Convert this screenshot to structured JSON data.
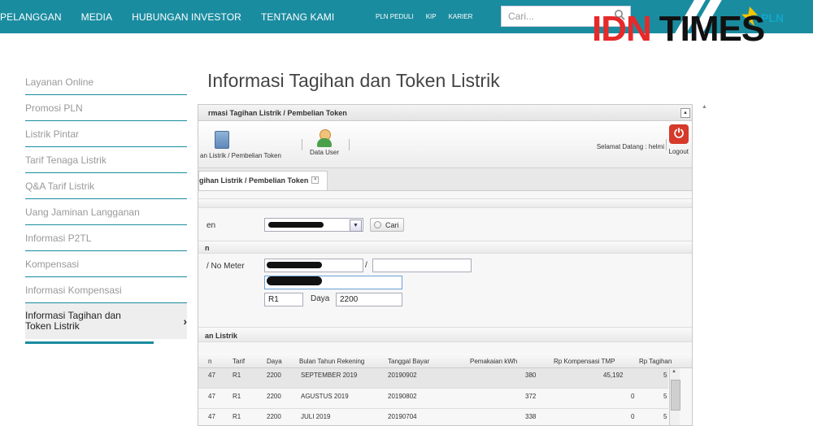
{
  "nav": {
    "main": [
      "PELANGGAN",
      "MEDIA",
      "HUBUNGAN INVESTOR",
      "TENTANG KAMI"
    ],
    "small": [
      "PLN PEDULI",
      "KIP",
      "KARIER"
    ],
    "search_placeholder": "Cari...",
    "brand_red": "IDN",
    "brand_black": "TIMES",
    "pln_text": "PLN"
  },
  "sidebar": {
    "items": [
      "Layanan Online",
      "Promosi PLN",
      "Listrik Pintar",
      "Tarif Tenaga Listrik",
      "Q&A Tarif Listrik",
      "Uang Jaminan Langganan",
      "Informasi P2TL",
      "Kompensasi",
      "Informasi Kompensasi"
    ],
    "active": "Informasi Tagihan dan Token Listrik"
  },
  "page": {
    "title": "Informasi Tagihan dan Token Listrik"
  },
  "app": {
    "panel_title": "rmasi Tagihan Listrik / Pembelian Token",
    "toolbar": {
      "btn1": "an Listrik / Pembelian Token",
      "btn2": "Data User",
      "welcome": "Selamat Datang : helmi",
      "logout": "Logout"
    },
    "tab": "gihan Listrik / Pembelian Token",
    "tab_close": "×",
    "sec2_hdr": "n",
    "label_id": "en",
    "cari": "Cari",
    "label_meter": "/ No Meter",
    "slash": "/",
    "tarif_value": "R1",
    "daya_label": "Daya",
    "daya_value": "2200",
    "sec3_hdr": "an Listrik",
    "table": {
      "headers": [
        "n",
        "Tarif",
        "Daya",
        "Bulan Tahun Rekening",
        "Tanggal Bayar",
        "Pemakaian kWh",
        "Rp Kompensasi TMP",
        "Rp Tagihan"
      ],
      "rows": [
        [
          "47",
          "R1",
          "2200",
          "SEPTEMBER 2019",
          "20190902",
          "380",
          "45,192",
          "5"
        ],
        [
          "47",
          "R1",
          "2200",
          "AGUSTUS 2019",
          "20190802",
          "372",
          "0",
          "5"
        ],
        [
          "47",
          "R1",
          "2200",
          "JULI 2019",
          "20190704",
          "338",
          "0",
          "5"
        ]
      ]
    }
  }
}
